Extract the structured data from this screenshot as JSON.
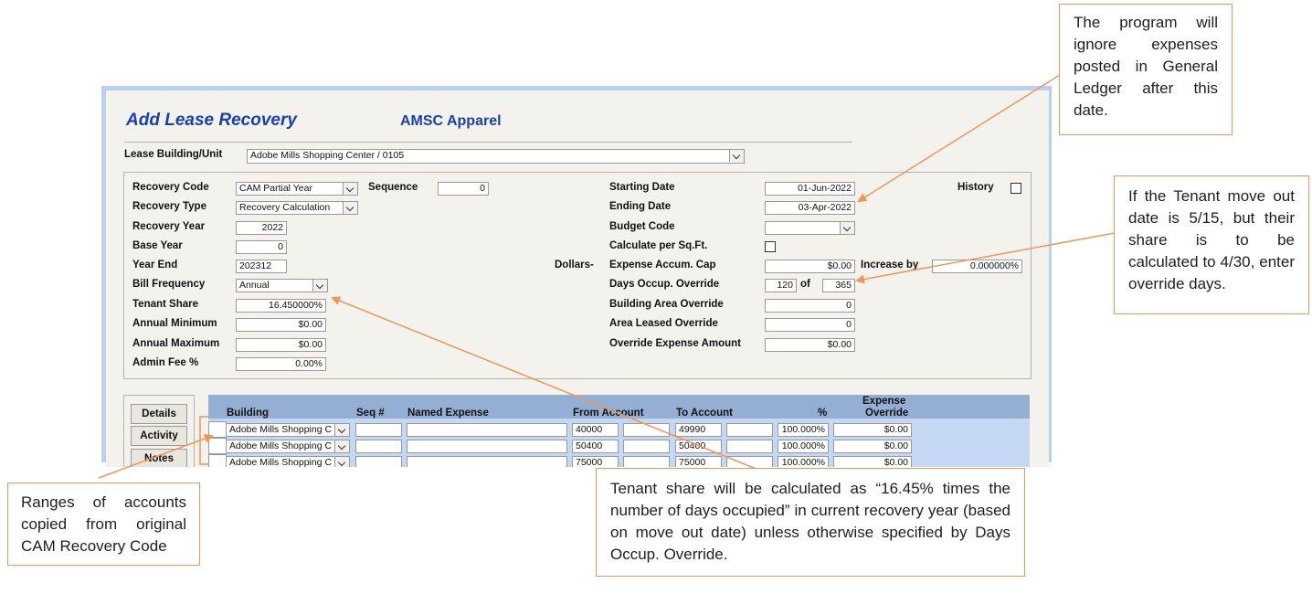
{
  "window": {
    "title": "Add Lease Recovery",
    "tenant": "AMSC Apparel",
    "lease_label": "Lease Building/Unit",
    "lease_value": "Adobe Mills Shopping Center /     0105"
  },
  "left_fields": {
    "recovery_code": {
      "label": "Recovery Code",
      "value": "CAM Partial Year"
    },
    "sequence": {
      "label": "Sequence",
      "value": "0"
    },
    "recovery_type": {
      "label": "Recovery Type",
      "value": "Recovery Calculation"
    },
    "recovery_year": {
      "label": "Recovery Year",
      "value": "2022"
    },
    "base_year": {
      "label": "Base Year",
      "value": "0"
    },
    "year_end": {
      "label": "Year End",
      "value": "202312"
    },
    "bill_frequency": {
      "label": "Bill Frequency",
      "value": "Annual"
    },
    "tenant_share": {
      "label": "Tenant Share",
      "value": "16.450000%"
    },
    "annual_minimum": {
      "label": "Annual Minimum",
      "value": "$0.00"
    },
    "annual_maximum": {
      "label": "Annual Maximum",
      "value": "$0.00"
    },
    "admin_fee": {
      "label": "Admin Fee %",
      "value": "0.00%"
    }
  },
  "right_fields": {
    "starting_date": {
      "label": "Starting Date",
      "value": "01-Jun-2022"
    },
    "history_label": "History",
    "ending_date": {
      "label": "Ending Date",
      "value": "03-Apr-2022"
    },
    "budget_code": {
      "label": "Budget Code",
      "value": ""
    },
    "calc_per_sqft": {
      "label": "Calculate per Sq.Ft."
    },
    "dollars_label": "Dollars-",
    "expense_cap": {
      "label": "Expense Accum. Cap",
      "value": "$0.00"
    },
    "increase_by": {
      "label": "Increase by",
      "value": "0.000000%"
    },
    "days_occup": {
      "label": "Days Occup. Override",
      "value": "120",
      "of_label": "of",
      "total": "365"
    },
    "building_area": {
      "label": "Building Area Override",
      "value": "0"
    },
    "area_leased": {
      "label": "Area Leased Override",
      "value": "0"
    },
    "override_expense": {
      "label": "Override Expense Amount",
      "value": "$0.00"
    }
  },
  "tabs": [
    "Details",
    "Activity",
    "Notes"
  ],
  "grid": {
    "headers": {
      "building": "Building",
      "seq": "Seq #",
      "named_expense": "Named Expense",
      "from_account": "From Account",
      "to_account": "To Account",
      "pct": "%",
      "expense_override_1": "Expense",
      "expense_override_2": "Override"
    },
    "rows": [
      {
        "building": "Adobe Mills Shopping C",
        "from": "40000",
        "to": "49990",
        "pct": "100.000%",
        "override": "$0.00"
      },
      {
        "building": "Adobe Mills Shopping C",
        "from": "50400",
        "to": "50400",
        "pct": "100.000%",
        "override": "$0.00"
      },
      {
        "building": "Adobe Mills Shopping C",
        "from": "75000",
        "to": "75000",
        "pct": "100.000%",
        "override": "$0.00"
      }
    ]
  },
  "callouts": {
    "ending_date": "The program will ignore expenses posted in General Ledger after this date.",
    "days_override": "If the Tenant move out date is 5/15, but their share is to be calculated to 4/30, enter override days.",
    "ranges": "Ranges of accounts copied from original CAM Recovery Code",
    "tenant_share": "Tenant share will be calculated as “16.45% times the number of days occupied” in current recovery year (based on move out date) unless otherwise specified by Days Occup. Override."
  },
  "colors": {
    "accent": "#f0955a",
    "title_blue": "#1a3fae",
    "grid_header": "#94afd3",
    "grid_body": "#c4d8f4"
  }
}
